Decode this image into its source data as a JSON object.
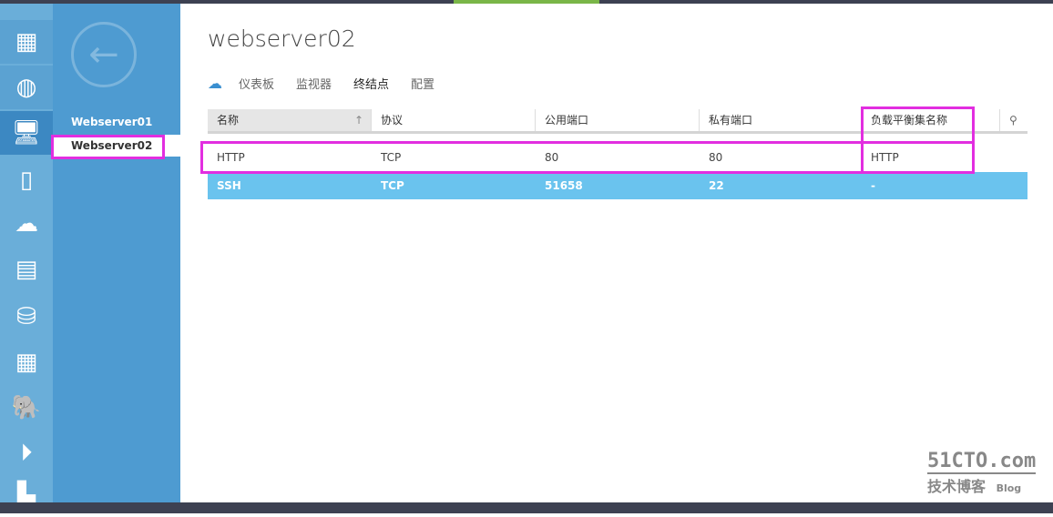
{
  "rail_icons": [
    "all-items-icon",
    "web-sites-icon",
    "virtual-machines-icon",
    "mobile-services-icon",
    "cloud-services-icon",
    "batch-icon",
    "sql-databases-icon",
    "storage-icon",
    "hdinsight-icon",
    "media-services-icon",
    "service-bus-icon"
  ],
  "nav": {
    "items": [
      {
        "label": "Webserver01"
      },
      {
        "label": "Webserver02"
      }
    ]
  },
  "page": {
    "title": "webserver02"
  },
  "tabs": [
    {
      "label": "仪表板"
    },
    {
      "label": "监视器"
    },
    {
      "label": "终结点"
    },
    {
      "label": "配置"
    }
  ],
  "table": {
    "headers": [
      "名称",
      "协议",
      "公用端口",
      "私有端口",
      "负载平衡集名称"
    ],
    "rows": [
      {
        "name": "HTTP",
        "protocol": "TCP",
        "public_port": "80",
        "private_port": "80",
        "lb_set": "HTTP"
      },
      {
        "name": "SSH",
        "protocol": "TCP",
        "public_port": "51658",
        "private_port": "22",
        "lb_set": "-"
      }
    ]
  },
  "watermark": {
    "line1": "51CTO.com",
    "line2": "技术博客",
    "line3": "Blog"
  },
  "colors": {
    "accent": "#4e9bd1",
    "highlight": "#e22ee0",
    "selected_row": "#6ac3ee"
  }
}
